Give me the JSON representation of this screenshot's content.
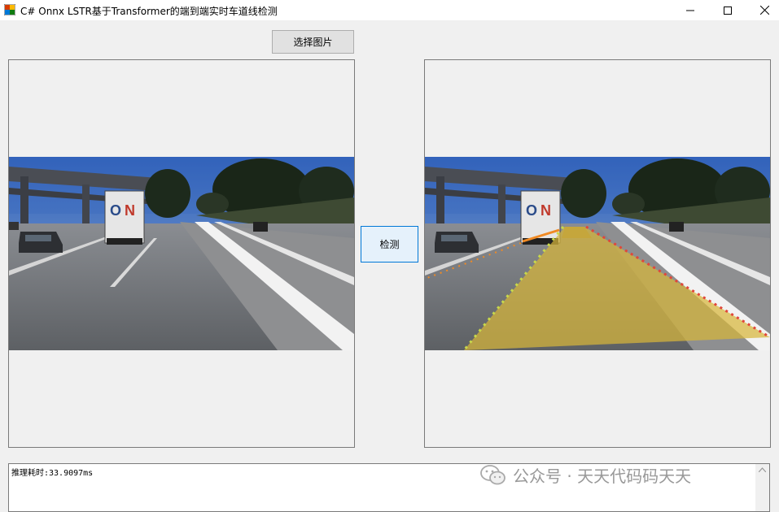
{
  "window": {
    "title": "C# Onnx LSTR基于Transformer的端到端实时车道线检测",
    "icon": "app-icon",
    "controls": {
      "minimize": "minimize-icon",
      "maximize": "maximize-icon",
      "close": "close-icon"
    }
  },
  "toolbar": {
    "select_image_label": "选择图片",
    "detect_label": "检测"
  },
  "output": {
    "log_text": "推理耗时:33.9097ms"
  },
  "watermark": {
    "text": "公众号 · 天天代码码天天",
    "icon": "wechat-icon"
  },
  "colors": {
    "window_bg": "#f0f0f0",
    "accent_border": "#0078d7",
    "lane_fill": "#d7b53a"
  }
}
